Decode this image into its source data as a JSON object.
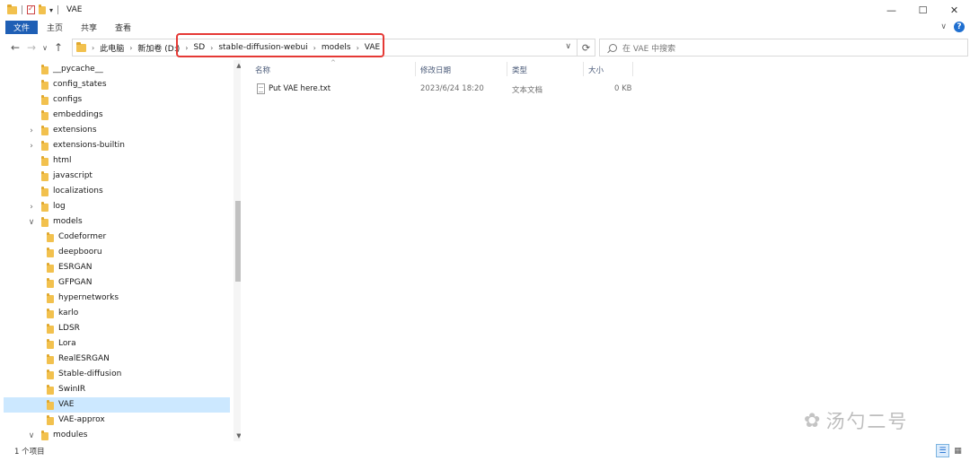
{
  "window": {
    "title": "VAE",
    "qa_dropdown": "▾",
    "minimize": "—",
    "maximize": "☐",
    "close": "✕"
  },
  "ribbon": {
    "tabs": [
      "文件",
      "主页",
      "共享",
      "查看"
    ],
    "expand": "∨",
    "help": "?"
  },
  "navigation": {
    "back": "←",
    "forward": "→",
    "recent": "∨",
    "up": "↑"
  },
  "address": {
    "crumbs": [
      "此电脑",
      "新加卷 (D:)",
      "SD",
      "stable-diffusion-webui",
      "models",
      "VAE"
    ],
    "separator": "›",
    "dropdown": "∨",
    "refresh": "⟳",
    "highlight_color": "#e53935"
  },
  "search": {
    "placeholder": "在 VAE 中搜索"
  },
  "tree": {
    "expander_collapsed": "›",
    "expander_expanded": "∨",
    "items": [
      {
        "label": "__pycache__",
        "level": 0,
        "expander": "",
        "selected": false
      },
      {
        "label": "config_states",
        "level": 0,
        "expander": "",
        "selected": false
      },
      {
        "label": "configs",
        "level": 0,
        "expander": "",
        "selected": false
      },
      {
        "label": "embeddings",
        "level": 0,
        "expander": "",
        "selected": false
      },
      {
        "label": "extensions",
        "level": 0,
        "expander": "collapsed",
        "selected": false
      },
      {
        "label": "extensions-builtin",
        "level": 0,
        "expander": "collapsed",
        "selected": false
      },
      {
        "label": "html",
        "level": 0,
        "expander": "",
        "selected": false
      },
      {
        "label": "javascript",
        "level": 0,
        "expander": "",
        "selected": false
      },
      {
        "label": "localizations",
        "level": 0,
        "expander": "",
        "selected": false
      },
      {
        "label": "log",
        "level": 0,
        "expander": "collapsed",
        "selected": false
      },
      {
        "label": "models",
        "level": 0,
        "expander": "expanded",
        "selected": false
      },
      {
        "label": "Codeformer",
        "level": 1,
        "expander": "",
        "selected": false
      },
      {
        "label": "deepbooru",
        "level": 1,
        "expander": "",
        "selected": false
      },
      {
        "label": "ESRGAN",
        "level": 1,
        "expander": "",
        "selected": false
      },
      {
        "label": "GFPGAN",
        "level": 1,
        "expander": "",
        "selected": false
      },
      {
        "label": "hypernetworks",
        "level": 1,
        "expander": "",
        "selected": false
      },
      {
        "label": "karlo",
        "level": 1,
        "expander": "",
        "selected": false
      },
      {
        "label": "LDSR",
        "level": 1,
        "expander": "",
        "selected": false
      },
      {
        "label": "Lora",
        "level": 1,
        "expander": "",
        "selected": false
      },
      {
        "label": "RealESRGAN",
        "level": 1,
        "expander": "",
        "selected": false
      },
      {
        "label": "Stable-diffusion",
        "level": 1,
        "expander": "",
        "selected": false
      },
      {
        "label": "SwinIR",
        "level": 1,
        "expander": "",
        "selected": false
      },
      {
        "label": "VAE",
        "level": 1,
        "expander": "",
        "selected": true
      },
      {
        "label": "VAE-approx",
        "level": 1,
        "expander": "",
        "selected": false
      },
      {
        "label": "modules",
        "level": 0,
        "expander": "expanded",
        "selected": false
      }
    ],
    "scroll_up": "▲",
    "scroll_down": "▼"
  },
  "columns": {
    "name": "名称",
    "modified": "修改日期",
    "type": "类型",
    "size": "大小",
    "sort_indicator": "^"
  },
  "files": [
    {
      "name": "Put VAE here.txt",
      "modified": "2023/6/24 18:20",
      "type": "文本文档",
      "size": "0 KB"
    }
  ],
  "status": {
    "item_count": "1 个项目"
  },
  "view": {
    "details_icon": "☰",
    "tiles_icon": "▦"
  },
  "watermark": {
    "icon": "✿",
    "text": "汤勺二号"
  }
}
